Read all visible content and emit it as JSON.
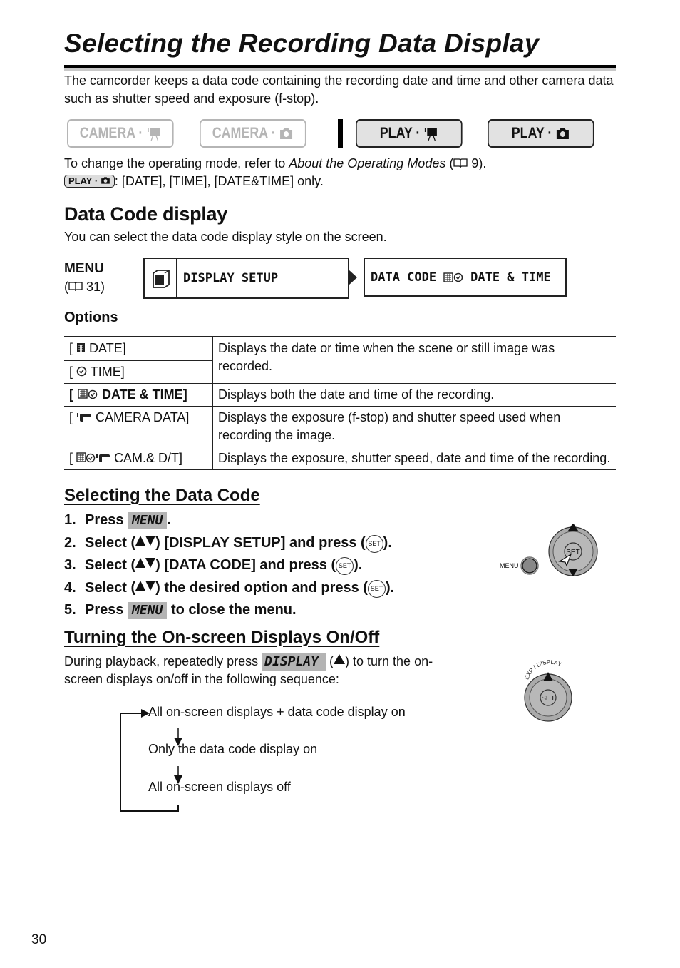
{
  "page": {
    "title": "Selecting the Recording Data Display",
    "intro": "The camcorder keeps a data code containing the recording date and time and other camera data such as shutter speed and exposure (f-stop).",
    "page_number": "30"
  },
  "modes": [
    {
      "label": "CAMERA ·",
      "icon": "movie-camera-icon",
      "active": false
    },
    {
      "label": "CAMERA ·",
      "icon": "still-camera-icon",
      "active": false
    },
    {
      "label": "PLAY ·",
      "icon": "movie-camera-icon",
      "active": true
    },
    {
      "label": "PLAY ·",
      "icon": "still-camera-icon",
      "active": true
    }
  ],
  "mode_note": {
    "prefix": "To change the operating mode, refer to ",
    "link": "About the Operating Modes",
    "ref_open": " (",
    "ref_page": " 9).",
    "badge": "PLAY ·",
    "restriction": ": [DATE], [TIME], [DATE&TIME] only."
  },
  "data_code": {
    "heading": "Data Code display",
    "subtitle": "You can select the data code display style on the screen.",
    "menu_label": "MENU",
    "menu_ref_open": "(",
    "menu_ref_page": " 31)",
    "lcd_menu": "DISPLAY SETUP",
    "lcd_item": "DATA CODE",
    "lcd_value": "DATE & TIME"
  },
  "options": {
    "label": "Options",
    "rows": [
      {
        "name": "DATE",
        "icon": "calendar-icon",
        "bold": false,
        "description": "Displays the date or time when the scene or still image was recorded."
      },
      {
        "name": "TIME",
        "icon": "clock-icon",
        "bold": false,
        "description": ""
      },
      {
        "name": "DATE & TIME",
        "icon": "calendar-clock-icon",
        "bold": true,
        "description": "Displays both the date and time of the recording."
      },
      {
        "name": "CAMERA DATA",
        "icon": "camera-data-icon",
        "bold": false,
        "description": "Displays the exposure (f-stop) and shutter speed used when recording the image."
      },
      {
        "name": "CAM.& D/T",
        "icon": "cam-date-time-icon",
        "bold": false,
        "description": "Displays the exposure, shutter speed, date and time of the recording."
      }
    ]
  },
  "selecting": {
    "heading": "Selecting the Data Code",
    "steps": [
      {
        "num": "1.",
        "pre": "Press ",
        "key": "MENU",
        "post": "."
      },
      {
        "num": "2.",
        "pre": "Select (",
        "post": ") [DISPLAY SETUP] and press (",
        "end": ")."
      },
      {
        "num": "3.",
        "pre": "Select (",
        "post": ") [DATA CODE] and press (",
        "end": ")."
      },
      {
        "num": "4.",
        "pre": "Select (",
        "post": ") the desired option and press (",
        "end": ")."
      },
      {
        "num": "5.",
        "pre": "Press ",
        "key": "MENU",
        "post": " to close the menu."
      }
    ],
    "set_label": "SET",
    "diagram_menu_label": "MENU",
    "diagram_set_label": "SET"
  },
  "onscreen": {
    "heading": "Turning the On-screen Displays On/Off",
    "para_pre": "During playback, repeatedly press ",
    "key": "DISPLAY",
    "para_mid": " (",
    "para_post": ") to turn the on-screen displays on/off in the following sequence:",
    "dial_label": "EXP / DISPLAY",
    "dial_set": "SET",
    "sequence": [
      "All on-screen displays + data code display on",
      "Only the data code display on",
      "All on-screen displays off"
    ]
  }
}
